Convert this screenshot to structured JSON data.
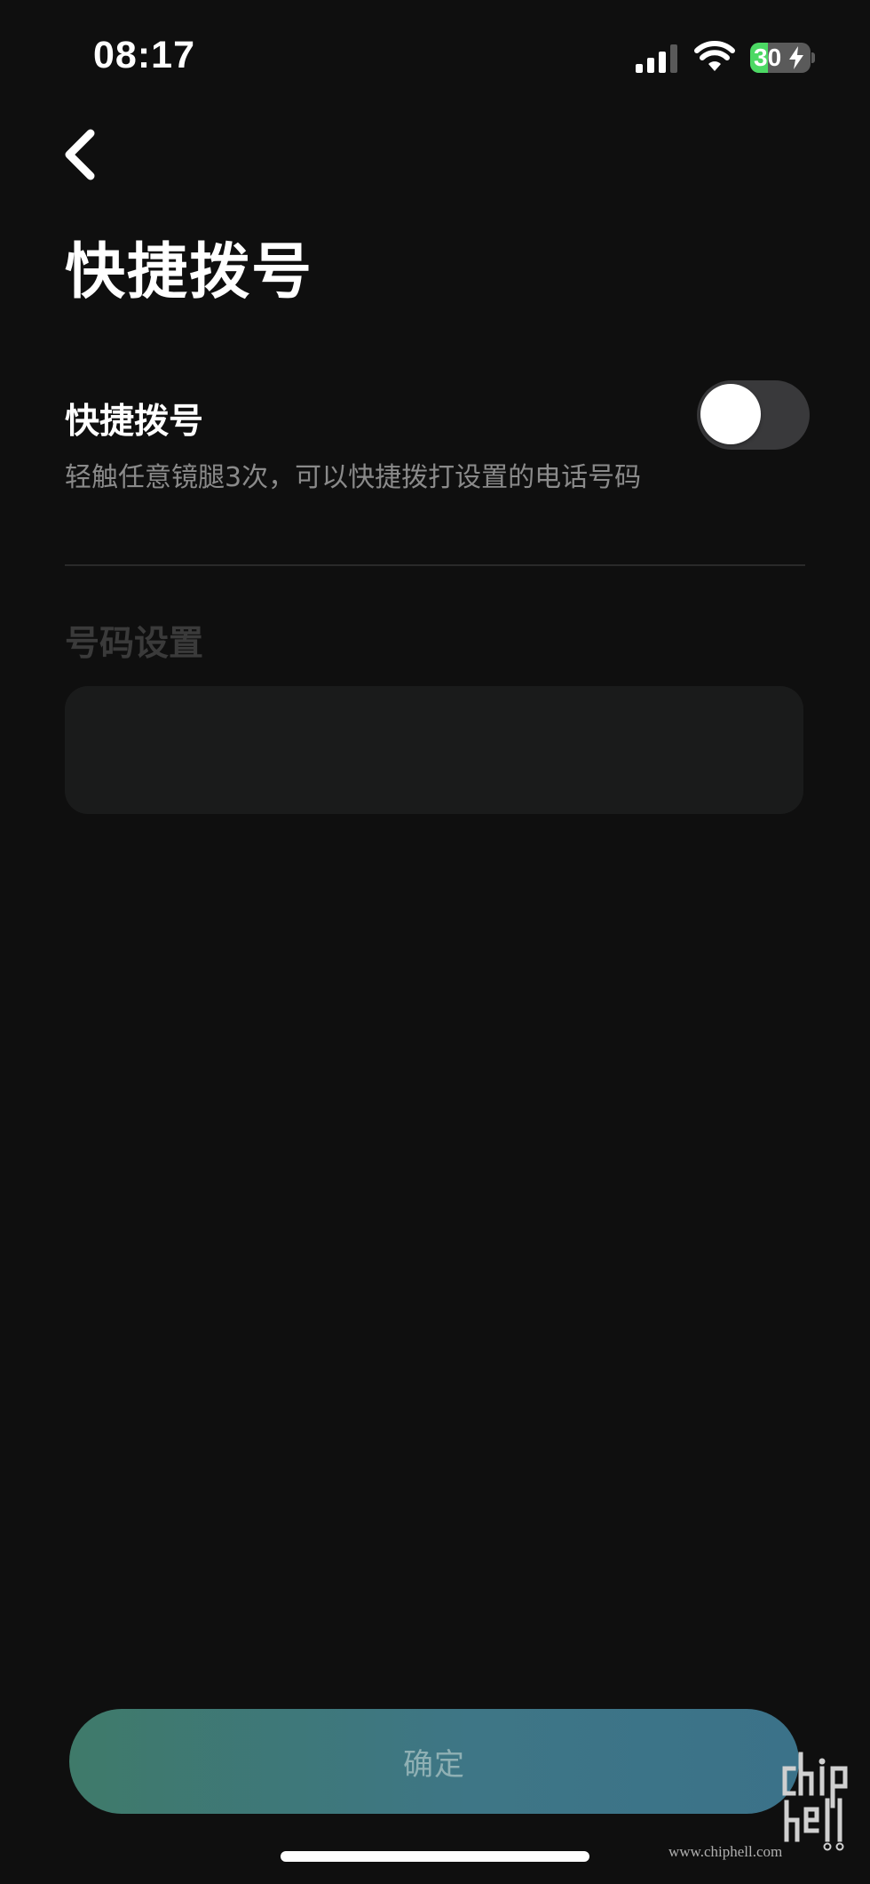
{
  "status_bar": {
    "time": "08:17",
    "battery_level": "30",
    "battery_fraction": 0.3,
    "icons": [
      "cellular-signal-icon",
      "wifi-icon",
      "battery-charging-icon"
    ]
  },
  "nav": {
    "back_icon": "chevron-left-icon"
  },
  "page": {
    "title": "快捷拨号"
  },
  "quick_dial": {
    "label": "快捷拨号",
    "description": "轻触任意镜腿3次，可以快捷拨打设置的电话号码",
    "enabled": false
  },
  "number_settings": {
    "section_title": "号码设置",
    "value": "",
    "placeholder": ""
  },
  "footer": {
    "confirm_label": "确定"
  },
  "watermark": {
    "url": "www.chiphell.com",
    "logo": "chiphell-logo"
  },
  "colors": {
    "background": "#0f0f0f",
    "toggle_off": "#39393b",
    "battery_green": "#4cd964",
    "button_gradient_start": "#3f7a6a",
    "button_gradient_end": "#3b7289"
  }
}
